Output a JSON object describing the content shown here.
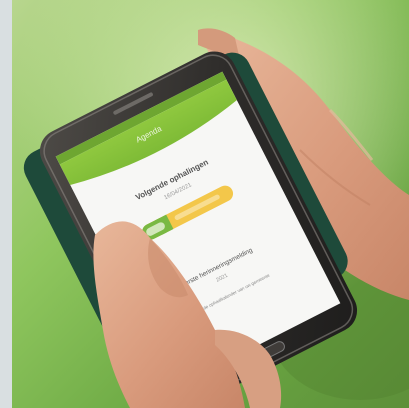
{
  "screen": {
    "header_title": "Agenda",
    "section_title": "Volgende ophalingen",
    "section_date": "16/04/2021",
    "pill_label": "",
    "next_title": "Eerste herinneringsmelding",
    "next_sub": "2021",
    "footer_note": "Bekijk de ophaalkalender van uw gemeente"
  },
  "colors": {
    "brand_green": "#8cc63f",
    "header_green": "#8cc63f",
    "pill_yellow": "#f3c74a",
    "pill_green": "#79b943"
  }
}
